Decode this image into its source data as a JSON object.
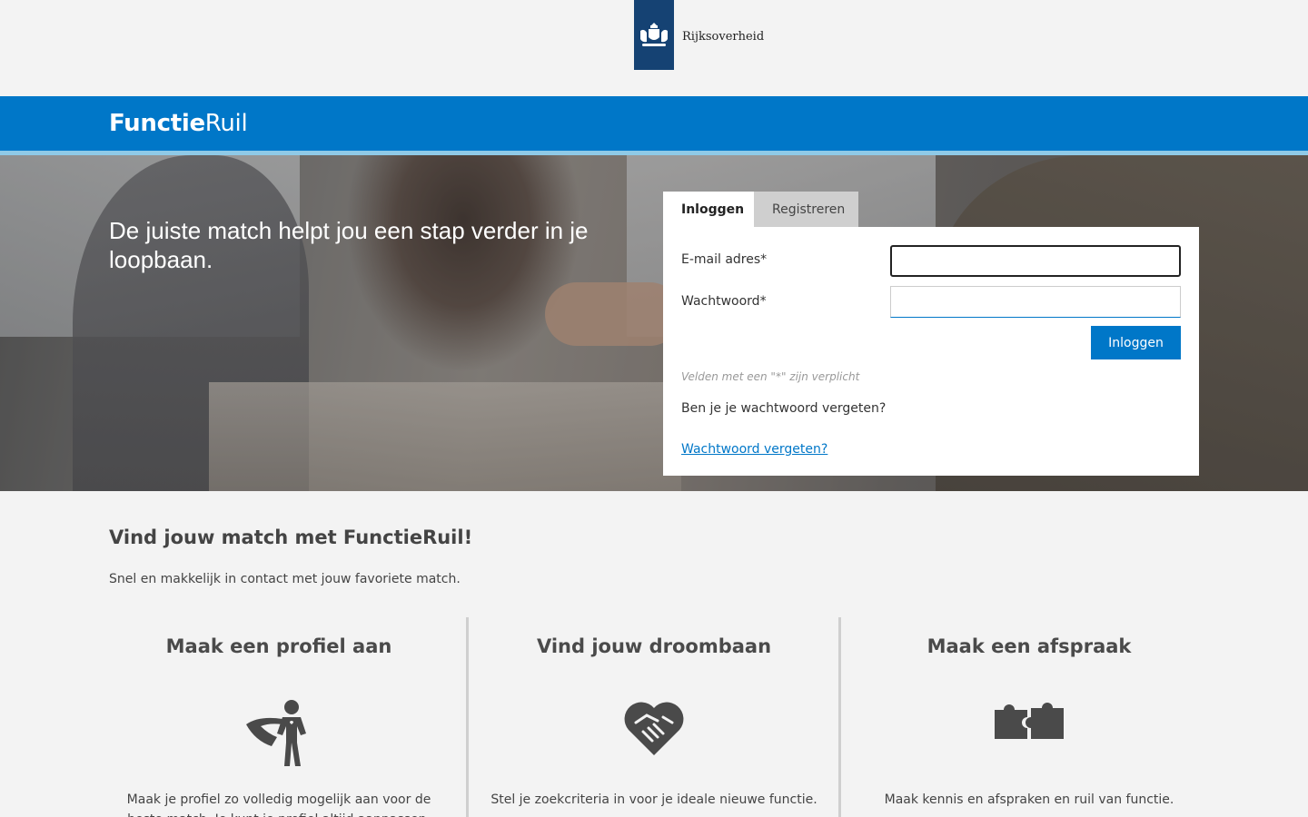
{
  "header": {
    "logo_text": "Rijksoverheid"
  },
  "brand": {
    "bold": "Functie",
    "normal": "Ruil"
  },
  "hero": {
    "title": "De juiste match helpt jou een stap verder in je loopbaan."
  },
  "login": {
    "tabs": [
      {
        "label": "Inloggen",
        "active": true
      },
      {
        "label": "Registreren",
        "active": false
      }
    ],
    "email_label": "E-mail adres*",
    "email_value": "",
    "password_label": "Wachtwoord*",
    "password_value": "",
    "submit_label": "Inloggen",
    "required_note": "Velden met een \"*\" zijn verplicht",
    "forgot_question": "Ben je je wachtwoord vergeten?",
    "forgot_link": "Wachtwoord vergeten?"
  },
  "intro": {
    "title": "Vind jouw match met FunctieRuil!",
    "subtitle": "Snel en makkelijk in contact met jouw favoriete match."
  },
  "features": [
    {
      "title": "Maak een profiel aan",
      "icon": "superhero-icon",
      "text": "Maak je profiel zo volledig mogelijk aan voor de beste match. Je kunt je profiel altijd aanpassen."
    },
    {
      "title": "Vind jouw droombaan",
      "icon": "handshake-heart-icon",
      "text": "Stel je zoekcriteria in voor je ideale nieuwe functie."
    },
    {
      "title": "Maak een afspraak",
      "icon": "puzzle-icon",
      "text": "Maak kennis en afspraken en ruil van functie."
    }
  ],
  "colors": {
    "primary_blue": "#0077c8",
    "logo_navy": "#154273",
    "background": "#f3f3f3"
  }
}
